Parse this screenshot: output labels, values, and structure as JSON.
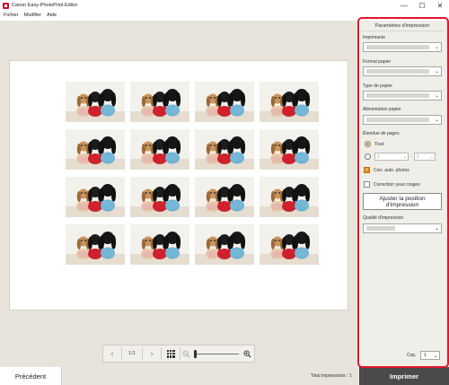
{
  "window": {
    "title": "Canon Easy-PhotoPrint Editor",
    "minimize": "—",
    "maximize": "☐",
    "close": "✕"
  },
  "menu": [
    "Fichier",
    "Modifier",
    "Aide"
  ],
  "preview": {
    "photo_count": 16,
    "page_indicator": "1/1"
  },
  "panel": {
    "heading": "Paramètres d'impression",
    "printer_label": "Imprimante",
    "paper_size_label": "Format papier",
    "media_type_label": "Type de papier",
    "paper_source_label": "Alimentation papier",
    "page_range_label": "Étendue de pages",
    "all_label": "Tout",
    "range_from": "1",
    "range_to": "1",
    "range_dash": "-",
    "auto_correct_label": "Corr. auto. photos",
    "auto_correct_checked": true,
    "redeye_label": "Correction yeux rouges",
    "redeye_checked": false,
    "adjust_button": "Ajuster la position d'impression",
    "quality_label": "Qualité d'impression",
    "copies_label": "Cop.",
    "copies_value": "1"
  },
  "footer": {
    "previous": "Précédent",
    "total_prints": "Total impressions : 1",
    "print": "Imprimer"
  },
  "colors": {
    "highlight": "#e3162b",
    "print_button": "#4a4a4a",
    "checkbox_on": "#e0891e",
    "radio_on": "#c77a00"
  }
}
